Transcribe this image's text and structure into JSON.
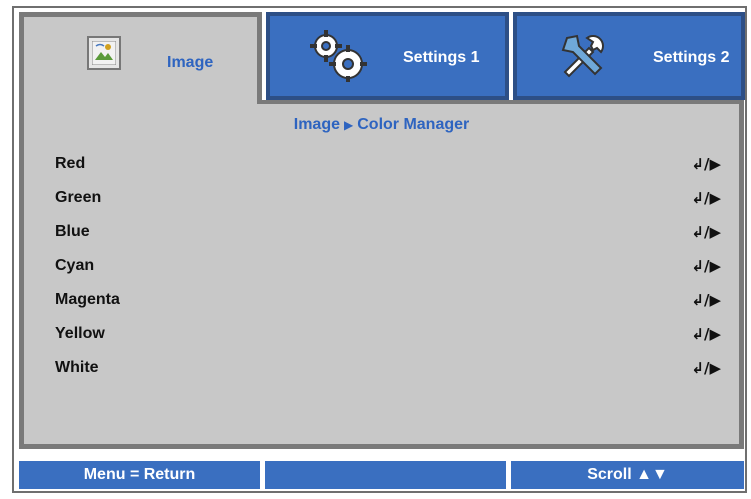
{
  "tabs": {
    "image": {
      "label": "Image",
      "icon": "image-icon"
    },
    "settings1": {
      "label": "Settings 1",
      "icon": "gears-icon"
    },
    "settings2": {
      "label": "Settings 2",
      "icon": "tools-icon"
    }
  },
  "breadcrumb": {
    "parent": "Image",
    "separator_icon": "triangle-right-icon",
    "current": "Color Manager"
  },
  "menu": {
    "items": [
      {
        "label": "Red",
        "action": "↲/▶"
      },
      {
        "label": "Green",
        "action": "↲/▶"
      },
      {
        "label": "Blue",
        "action": "↲/▶"
      },
      {
        "label": "Cyan",
        "action": "↲/▶"
      },
      {
        "label": "Magenta",
        "action": "↲/▶"
      },
      {
        "label": "Yellow",
        "action": "↲/▶"
      },
      {
        "label": "White",
        "action": "↲/▶"
      }
    ]
  },
  "footer": {
    "left": "Menu = Return",
    "middle": "",
    "right": "Scroll ▲▼"
  },
  "colors": {
    "accent": "#3a6fc0",
    "panel": "#c8c8c8",
    "border": "#7a7a7a",
    "label_blue": "#2e64c0"
  }
}
